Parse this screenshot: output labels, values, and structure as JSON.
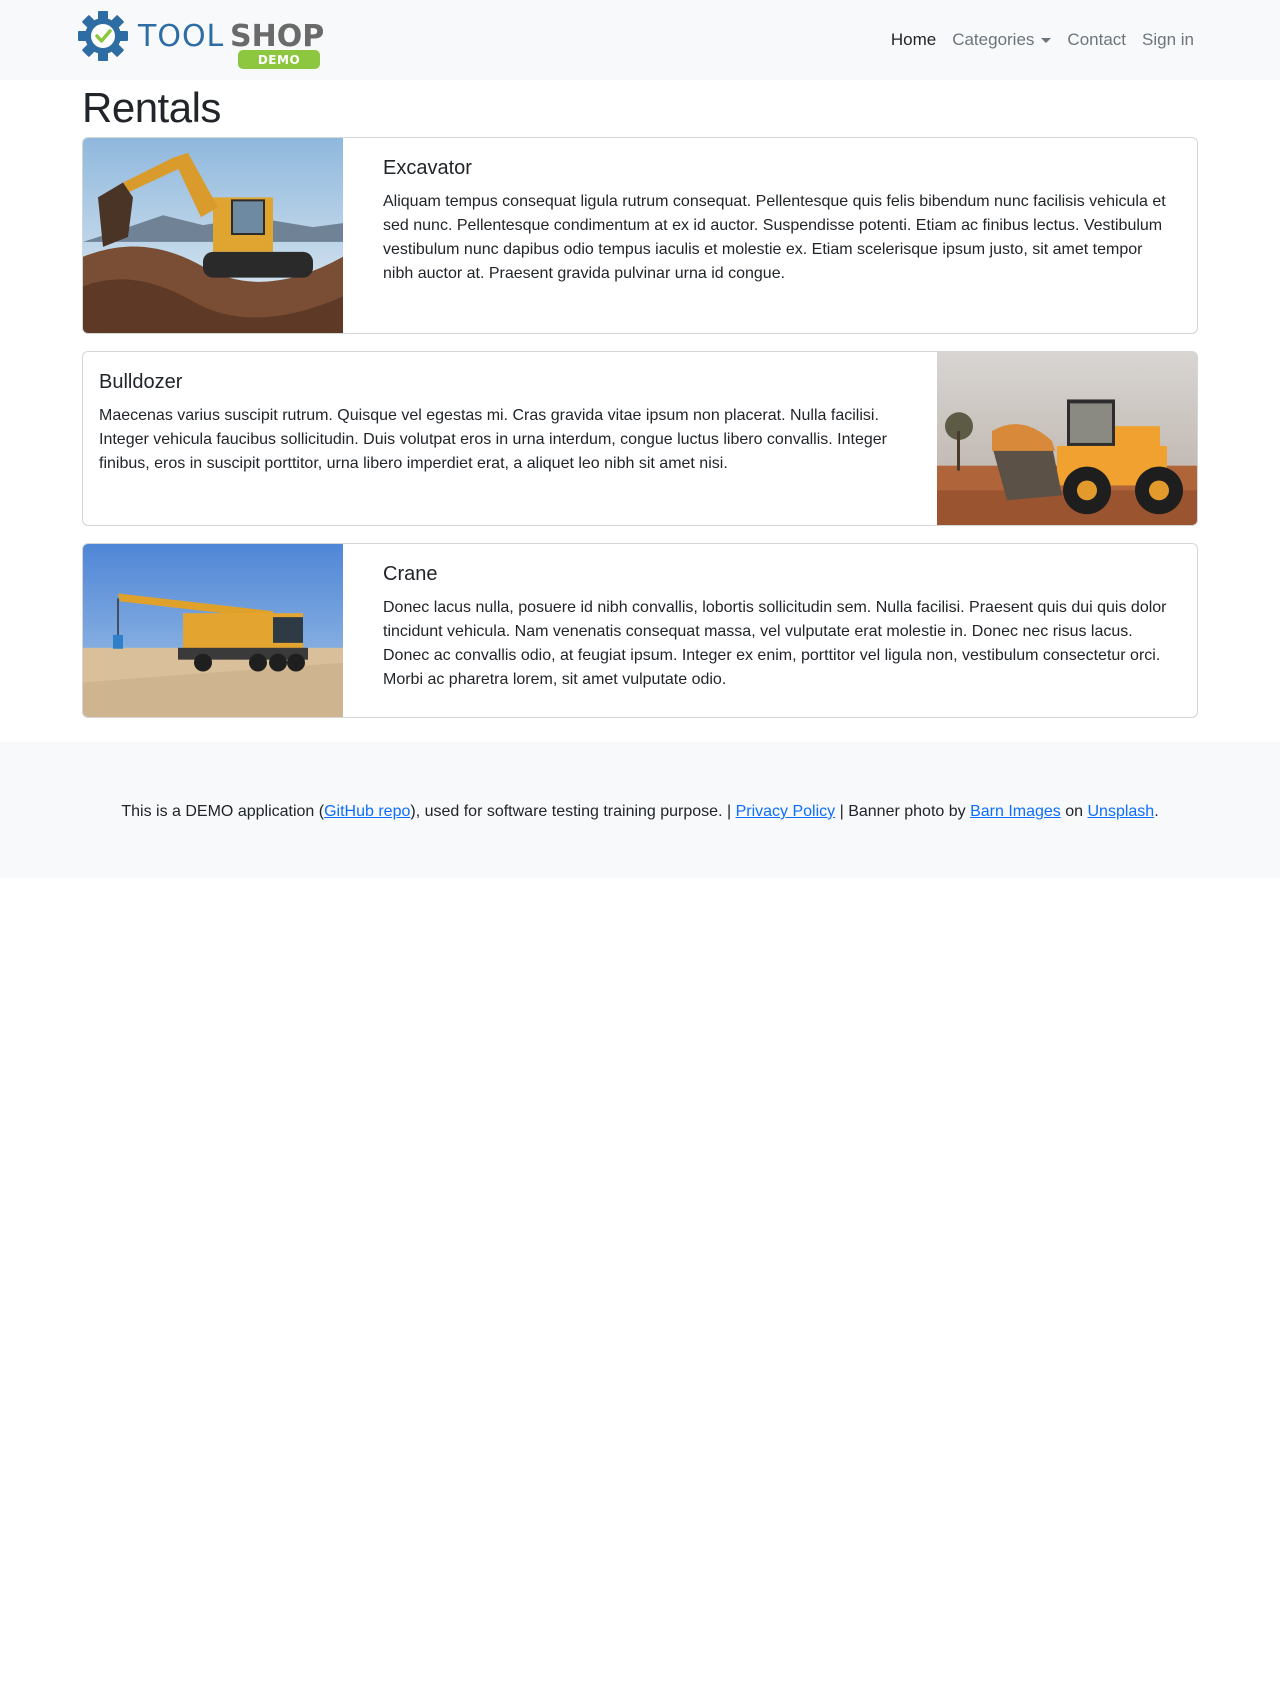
{
  "brand": {
    "name_part1": "TOOL",
    "name_part2": "SHOP",
    "badge": "DEMO",
    "colors": {
      "blue": "#2e6da4",
      "gray": "#6a6a6a",
      "green": "#8dc63f"
    }
  },
  "nav": {
    "home": "Home",
    "categories": "Categories",
    "contact": "Contact",
    "signin": "Sign in"
  },
  "page_title": "Rentals",
  "rentals": [
    {
      "title": "Excavator",
      "text": "Aliquam tempus consequat ligula rutrum consequat. Pellentesque quis felis bibendum nunc facilisis vehicula et sed nunc. Pellentesque condimentum at ex id auctor. Suspendisse potenti. Etiam ac finibus lectus. Vestibulum vestibulum nunc dapibus odio tempus iaculis et molestie ex. Etiam scelerisque ipsum justo, sit amet tempor nibh auctor at. Praesent gravida pulvinar urna id congue."
    },
    {
      "title": "Bulldozer",
      "text": "Maecenas varius suscipit rutrum. Quisque vel egestas mi. Cras gravida vitae ipsum non placerat. Nulla facilisi. Integer vehicula faucibus sollicitudin. Duis volutpat eros in urna interdum, congue luctus libero convallis. Integer finibus, eros in suscipit porttitor, urna libero imperdiet erat, a aliquet leo nibh sit amet nisi."
    },
    {
      "title": "Crane",
      "text": "Donec lacus nulla, posuere id nibh convallis, lobortis sollicitudin sem. Nulla facilisi. Praesent quis dui quis dolor tincidunt vehicula. Nam venenatis consequat massa, vel vulputate erat molestie in. Donec nec risus lacus. Donec ac convallis odio, at feugiat ipsum. Integer ex enim, porttitor vel ligula non, vestibulum consectetur orci. Morbi ac pharetra lorem, sit amet vulputate odio."
    }
  ],
  "footer": {
    "t1": "This is a DEMO application (",
    "github": "GitHub repo",
    "t2": "), used for software testing training purpose. | ",
    "privacy": "Privacy Policy",
    "t3": " | Banner photo by ",
    "barn": "Barn Images",
    "t4": " on ",
    "unsplash": "Unsplash",
    "t5": "."
  }
}
